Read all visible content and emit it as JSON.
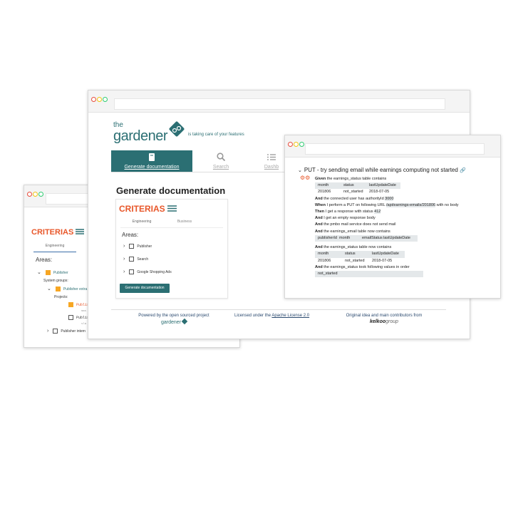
{
  "back_window": {
    "criterias_title": "CRITERIAS",
    "tabs": [
      "Engineering"
    ],
    "areas_label": "Areas:",
    "tree": {
      "publisher": "Publisher",
      "system_groups_label": "System groups:",
      "publisher_extra": "Publisher extra",
      "projects_label": "Projects:",
      "project1": "Publis",
      "project1_sub": "mas",
      "project2": "Publis",
      "project2_sub": "sla",
      "publisher_intern": "Publisher intern"
    }
  },
  "main_window": {
    "logo_the": "the",
    "logo_name": "gardener",
    "tagline": "is taking care of your features",
    "nav": [
      {
        "label": "Generate documentation",
        "icon": "book-icon",
        "active": true
      },
      {
        "label": "Search",
        "icon": "search-icon",
        "active": false
      },
      {
        "label": "Dashb",
        "icon": "list-icon",
        "active": false
      }
    ],
    "page_title": "Generate documentation",
    "criterias_title": "CRITERIAS",
    "tabs": [
      "Engineering",
      "Business"
    ],
    "areas_label": "Areas:",
    "areas": [
      "Publisher",
      "Search",
      "Google Shopping Ads"
    ],
    "generate_button": "Generate documentation",
    "footer": {
      "powered": "Powered by the open sourced project",
      "powered_logo": "gardener",
      "license_prefix": "Licensed under the",
      "license_link": "Apache License 2.0",
      "original": "Original idea and main contributors from",
      "original_logo_a": "kelkoo",
      "original_logo_b": "group"
    }
  },
  "scenario_window": {
    "title": "PUT - try sending email while earnings computing not started",
    "steps": {
      "given": "Given",
      "and": "And",
      "when": "When",
      "then": "Then",
      "given_text": "the earnings_status table contains",
      "table1_headers": [
        "month",
        "status",
        "lastUpdateDate"
      ],
      "table1_row": [
        "201806",
        "not_started",
        "2018-07-05"
      ],
      "and1_text": "the connected user has authorityId",
      "and1_value": "3000",
      "when_text": "I perform a PUT on following URL",
      "when_url": "/api/earnings-emails/201806",
      "when_suffix": "with no body",
      "then_text": "I get a response with status",
      "then_value": "412",
      "and2_text": "I get an empty response body",
      "and3_text": "the pmbo mail service does not send mail",
      "and4_text": "the earnings_email table now contains",
      "table2_headers": [
        "publisherId",
        "month",
        "emailStatus",
        "lastUpdateDate"
      ],
      "and5_text": "the earnings_status table now contains",
      "table3_headers": [
        "month",
        "status",
        "lastUpdateDate"
      ],
      "table3_row": [
        "201806",
        "not_started",
        "2018-07-05"
      ],
      "and6_text": "the earnings_status took following values in order",
      "table4_row": [
        "not_started"
      ]
    }
  },
  "colors": {
    "teal": "#2b6f73",
    "orange": "#e8572a",
    "highlight": "#e4e8ea"
  }
}
